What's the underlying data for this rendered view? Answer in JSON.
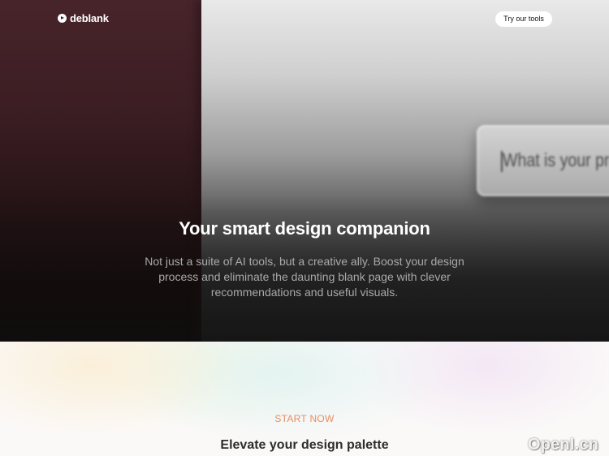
{
  "brand": {
    "name": "deblank",
    "icon": "play-circle-icon"
  },
  "nav": {
    "cta_label": "Try our tools"
  },
  "hero": {
    "prompt_placeholder": "What is your pro",
    "title": "Your smart design companion",
    "subtitle": "Not just a suite of AI tools, but a creative ally. Boost your design process and eliminate the daunting blank page with clever recommendations and useful visuals."
  },
  "section": {
    "eyebrow": "START NOW",
    "title": "Elevate your design palette"
  },
  "watermark": {
    "text": "OpenI.cn"
  },
  "colors": {
    "hero_left": "#3a1d22",
    "hero_right": "#9d9d9d",
    "eyebrow": "#e98d62",
    "section_title": "#2d2d2d"
  }
}
